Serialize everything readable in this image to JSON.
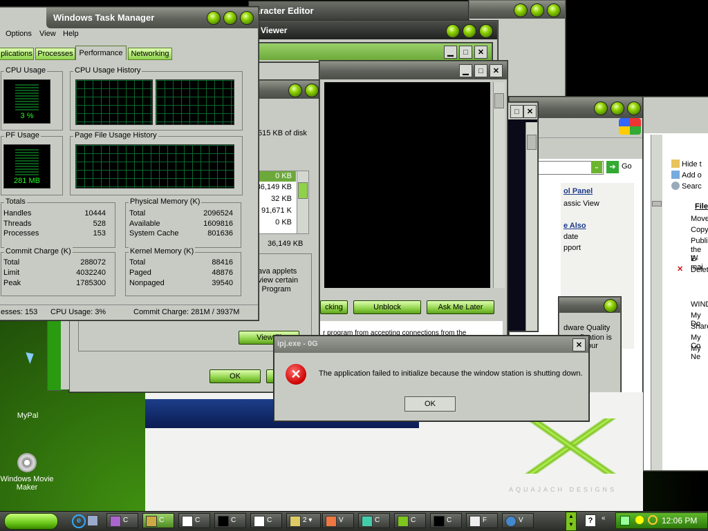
{
  "colors": {
    "accent": "#7dc41e",
    "graph_grid": "#0b6a2e",
    "graph_text": "#22ff22",
    "error_red": "#d21414"
  },
  "task_manager": {
    "title": "Windows Task Manager",
    "menu": [
      "Options",
      "View",
      "Help"
    ],
    "tabs": [
      "plications",
      "Processes",
      "Performance",
      "Networking"
    ],
    "cpu_usage_label": "CPU Usage",
    "cpu_usage_value": "3 %",
    "cpu_history_label": "CPU Usage History",
    "pf_usage_label": "PF Usage",
    "pf_usage_value": "281 MB",
    "pf_history_label": "Page File Usage History",
    "totals": {
      "label": "Totals",
      "rows": [
        [
          "Handles",
          "10444"
        ],
        [
          "Threads",
          "528"
        ],
        [
          "Processes",
          "153"
        ]
      ]
    },
    "physical": {
      "label": "Physical Memory (K)",
      "rows": [
        [
          "Total",
          "2096524"
        ],
        [
          "Available",
          "1609816"
        ],
        [
          "System Cache",
          "801636"
        ]
      ]
    },
    "commit": {
      "label": "Commit Charge (K)",
      "rows": [
        [
          "Total",
          "288072"
        ],
        [
          "Limit",
          "4032240"
        ],
        [
          "Peak",
          "1785300"
        ]
      ]
    },
    "kernel": {
      "label": "Kernel Memory (K)",
      "rows": [
        [
          "Total",
          "88416"
        ],
        [
          "Paged",
          "48876"
        ],
        [
          "Nonpaged",
          "39540"
        ]
      ]
    },
    "status": {
      "processes": "esses: 153",
      "cpu": "CPU Usage: 3%",
      "commit": "Commit Charge: 281M / 3937M"
    }
  },
  "bg_windows": {
    "char_editor_title": "aracter Editor",
    "viewer_title": "Viewer"
  },
  "disk_cleanup": {
    "disk_text": "515 KB of disk",
    "sizes": [
      "0 KB",
      "36,149 KB",
      "32 KB",
      "91,671 K",
      "0 KB"
    ],
    "total": "36,149 KB",
    "desc": [
      "ava applets",
      "view certain",
      "l Program"
    ],
    "view_files": "View Fi",
    "ok": "OK"
  },
  "firewall": {
    "keep_blocking": "cking",
    "unblock": "Unblock",
    "ask_later": "Ask Me Later",
    "text": "r program from accepting connections from the"
  },
  "explorer": {
    "go": "Go",
    "control_panel": "ol Panel",
    "classic_view": "assic View",
    "see_also": "e Also",
    "see_items": [
      "date",
      "pport"
    ],
    "hw_text": [
      "dware Quality",
      "fication is",
      "our"
    ]
  },
  "right_panel": {
    "tasks": [
      "Hide t",
      "Add o",
      "Searc"
    ],
    "file_heading": "File",
    "file_items": [
      "Move",
      "Copy",
      "Publis",
      "the W",
      "E-mai",
      "Delete"
    ],
    "places": [
      "WIND",
      "My Do",
      "Share",
      "My Co",
      "My Ne"
    ]
  },
  "error_dialog": {
    "title": "ipj.exe - 0G",
    "message": "The application failed to initialize because the window station is shutting down.",
    "ok": "OK"
  },
  "desktop": {
    "icons": [
      "MyPal",
      "Windows Movie Maker"
    ],
    "watermark": "AQUAJACH DESIGNS"
  },
  "taskbar": {
    "buttons": [
      "C",
      "C",
      "C",
      "C",
      "C",
      "2",
      "V",
      "C",
      "C",
      "C",
      "F",
      "V"
    ],
    "clock": "12:06 PM"
  }
}
